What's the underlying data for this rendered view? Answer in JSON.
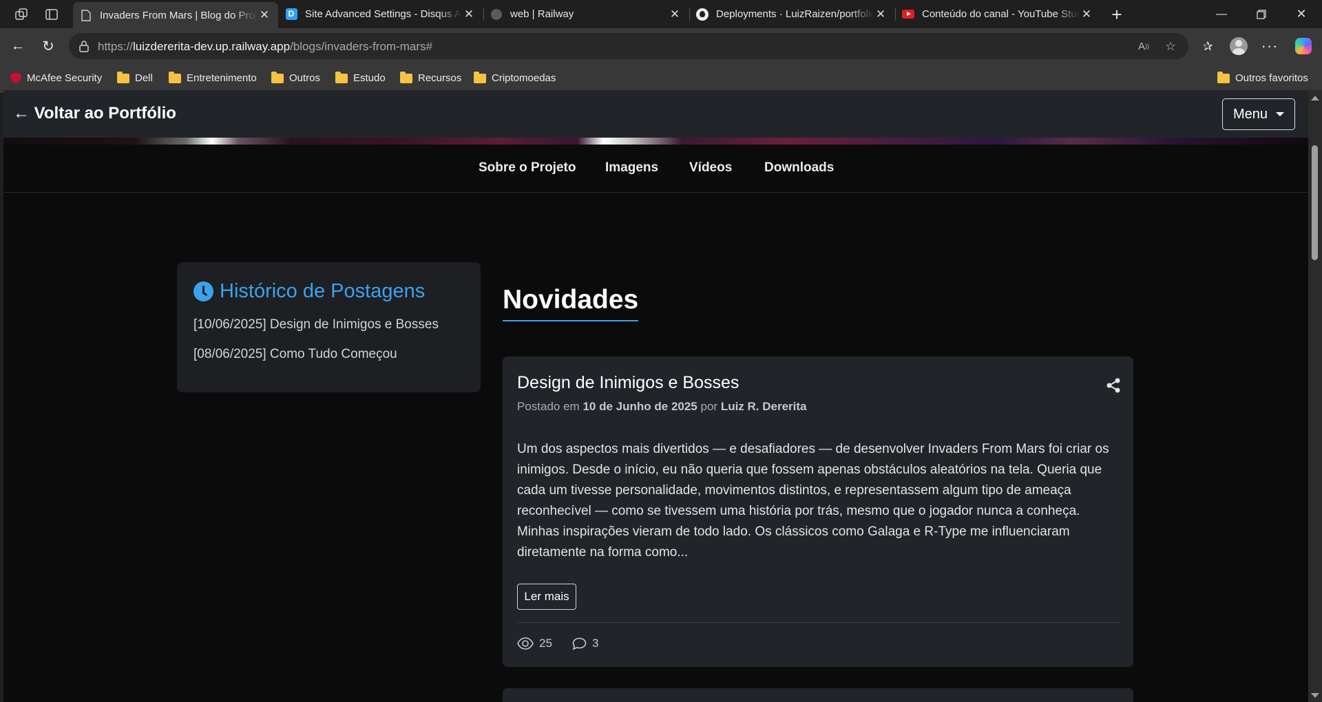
{
  "browser": {
    "tabs": [
      {
        "title": "Invaders From Mars | Blog do Projeto",
        "favicon": "page-icon",
        "active": true
      },
      {
        "title": "Site Advanced Settings - Disqus Admin",
        "favicon": "disqus-icon",
        "active": false
      },
      {
        "title": "web | Railway",
        "favicon": "railway-icon",
        "active": false
      },
      {
        "title": "Deployments · LuizRaizen/portfolio",
        "favicon": "github-icon",
        "active": false
      },
      {
        "title": "Conteúdo do canal - YouTube Studio",
        "favicon": "youtube-icon",
        "active": false
      }
    ],
    "url": {
      "prefix": "https://",
      "host": "luizdererita-dev.up.railway.app",
      "path": "/blogs/invaders-from-mars#"
    },
    "bookmarks": [
      {
        "label": "McAfee Security",
        "icon": "mcafee-icon"
      },
      {
        "label": "Dell",
        "icon": "folder-icon"
      },
      {
        "label": "Entretenimento",
        "icon": "folder-icon"
      },
      {
        "label": "Outros",
        "icon": "folder-icon"
      },
      {
        "label": "Estudo",
        "icon": "folder-icon"
      },
      {
        "label": "Recursos",
        "icon": "folder-icon"
      },
      {
        "label": "Criptomoedas",
        "icon": "folder-icon"
      }
    ],
    "other_favorites": "Outros favoritos"
  },
  "site": {
    "back_link": "← Voltar ao Portfólio",
    "menu_label": "Menu",
    "subnav": [
      "Sobre o Projeto",
      "Imagens",
      "Vídeos",
      "Downloads"
    ],
    "sidebar": {
      "title": "Histórico de Postagens",
      "posts": [
        "[10/06/2025] Design de Inimigos e Bosses",
        "[08/06/2025] Como Tudo Começou"
      ]
    },
    "section_title": "Novidades",
    "post": {
      "title": "Design de Inimigos e Bosses",
      "meta_posted": "Postado em",
      "meta_date": "10 de Junho de 2025",
      "meta_by": "por",
      "meta_author": "Luiz R. Dererita",
      "excerpt": "Um dos aspectos mais divertidos — e desafiadores — de desenvolver Invaders From Mars foi criar os inimigos. Desde o início, eu não queria que fossem apenas obstáculos aleatórios na tela. Queria que cada um tivesse personalidade, movimentos distintos, e representassem algum tipo de ameaça reconhecível — como se tivessem uma história por trás, mesmo que o jogador nunca a conheça. Minhas inspirações vieram de todo lado. Os clássicos como Galaga e R-Type me influenciaram diretamente na forma como...",
      "read_more": "Ler mais",
      "views": "25",
      "comments": "3"
    },
    "colors": {
      "accent": "#3aa3f0",
      "card": "#212529",
      "background": "#0b0b0b"
    }
  }
}
